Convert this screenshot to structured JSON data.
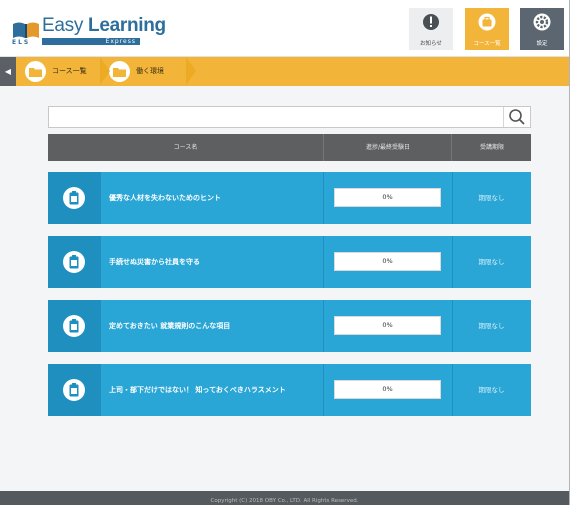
{
  "app": {
    "logo_main": "Easy",
    "logo_bold": "Learning",
    "logo_sub": "ELS",
    "logo_tagline": "Express"
  },
  "header": {
    "buttons": [
      {
        "label": "お知らせ",
        "icon": "exclamation-icon"
      },
      {
        "label": "コース一覧",
        "icon": "briefcase-icon"
      },
      {
        "label": "設定",
        "icon": "gear-icon"
      }
    ]
  },
  "breadcrumb": {
    "back": "◀",
    "items": [
      {
        "label": "コース一覧"
      },
      {
        "label": "働く環境"
      }
    ]
  },
  "search": {
    "value": "",
    "placeholder": ""
  },
  "table": {
    "headers": {
      "name": "コース名",
      "progress": "進捗/最終受験日",
      "period": "受講期限"
    },
    "rows": [
      {
        "title": "優秀な人材を失わないためのヒント",
        "progress_text": "0%",
        "progress": 0,
        "period": "期限なし"
      },
      {
        "title": "手続せぬ災害から社員を守る",
        "progress_text": "0%",
        "progress": 0,
        "period": "期限なし"
      },
      {
        "title": "定めておきたい 就業規則のこんな項目",
        "progress_text": "0%",
        "progress": 0,
        "period": "期限なし"
      },
      {
        "title": "上司・部下だけではない！ 知っておくべきハラスメント",
        "progress_text": "0%",
        "progress": 0,
        "period": "期限なし"
      }
    ]
  },
  "footer": {
    "text": "Copyright (C) 2018 OBY Co., LTD. All Rights Reserved."
  },
  "colors": {
    "accent": "#f2b53a",
    "row": "#29a6d6",
    "row_icon": "#1f8fc0",
    "header_dark": "#5d5f61"
  }
}
